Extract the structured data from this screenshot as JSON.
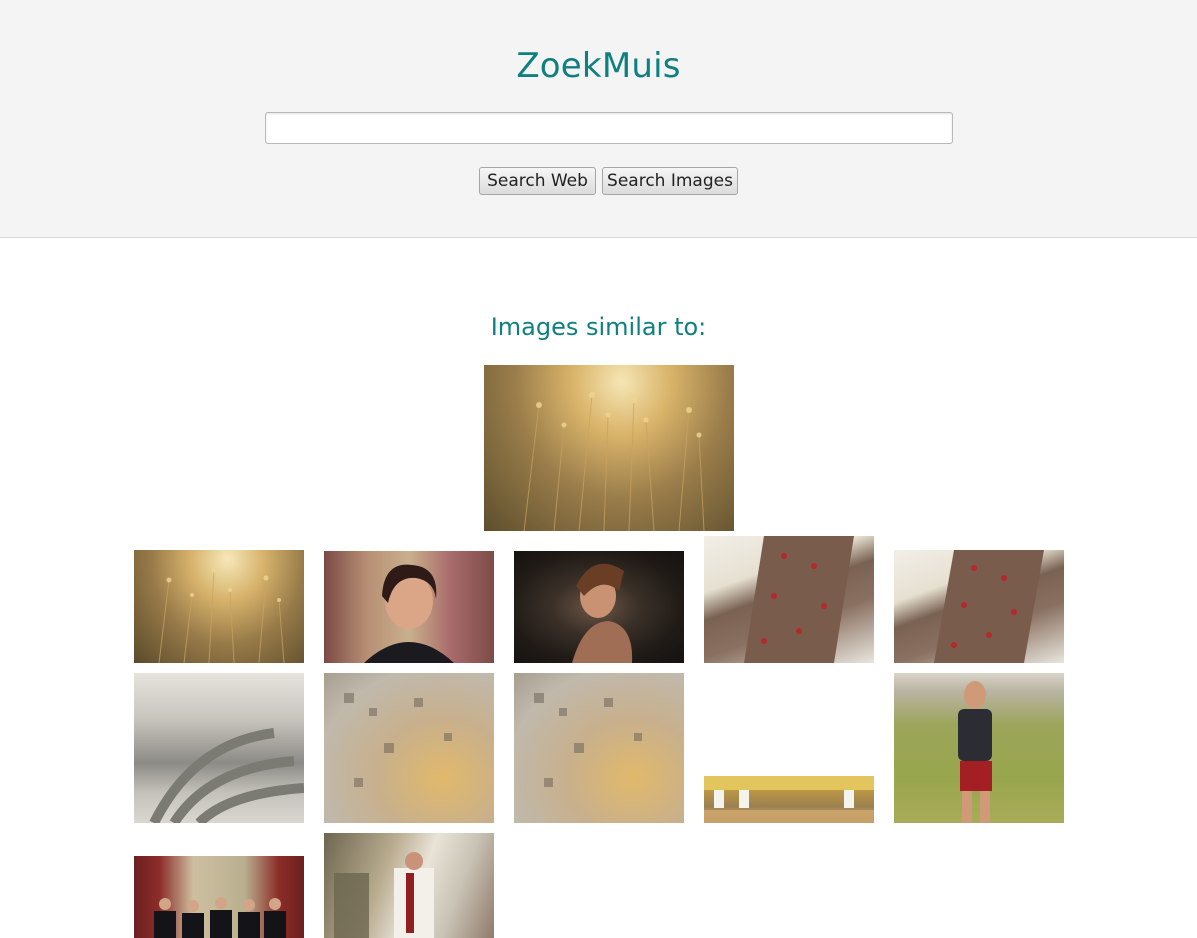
{
  "header": {
    "logo": "ZoekMuis",
    "search_input": {
      "value": "",
      "placeholder": ""
    },
    "buttons": {
      "search_web": "Search Web",
      "search_images": "Search Images"
    }
  },
  "main": {
    "title": "Images similar to:",
    "query_image": "query-image",
    "results": [
      "result-image-1",
      "result-image-2",
      "result-image-3",
      "result-image-4",
      "result-image-5",
      "result-image-6",
      "result-image-7",
      "result-image-8",
      "result-image-9",
      "result-image-10",
      "result-image-11",
      "result-image-12"
    ]
  },
  "colors": {
    "accent": "#0f8080",
    "header_bg": "#f4f4f4"
  }
}
